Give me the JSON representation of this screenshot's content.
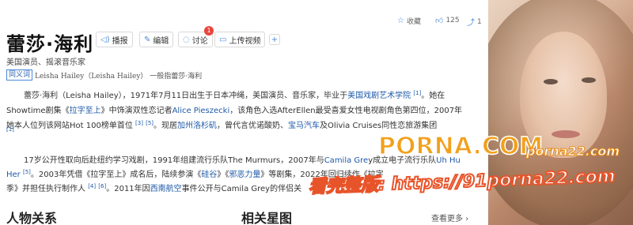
{
  "title": "蕾莎·海利",
  "top_actions": {
    "favorite": "收藏",
    "likes": "125",
    "shares": "1"
  },
  "toolbar": {
    "broadcast": "播报",
    "edit": "编辑",
    "discuss": "讨论",
    "discuss_badge": "1",
    "upload_video": "上传视频"
  },
  "description": "美国演员、摇滚音乐家",
  "synonym": {
    "tag": "同义词",
    "name": "Leisha Hailey（Leisha Hailey）",
    "rest": "一般指蕾莎·海利"
  },
  "para1": {
    "l1a": "蕾莎·海利（Leisha Hailey），1971年7月11日出生于日本冲绳，美国演员、音乐家，毕业于",
    "l1link": "美国戏剧艺术学院",
    "l1ref": "[1]",
    "l1b": "。她在",
    "l2a": "Showtime剧集《",
    "l2link1": "拉字至上",
    "l2b": "》中饰演双性恋记者",
    "l2link2": "Alice Pieszecki",
    "l2c": "，该角色入选AfterEllen最受喜爱女性电视剧角色第四位，2007年",
    "l3a": "她本人位列该网站Hot 100榜单首位",
    "l3ref1": "[3]",
    "l3ref2": "[5]",
    "l3b": "。现居",
    "l3link1": "加州洛杉矶",
    "l3c": "，曾代言优诺酸奶、",
    "l3link2": "宝马汽车",
    "l3d": "及Olivia Cruises同性恋旅游集团",
    "l4ref": "[1]"
  },
  "para2": {
    "l1a": "17岁公开性取向后赴纽约学习戏剧，1991年组建流行乐队The Murmurs，2007年与",
    "l1link1": "Camila Gre",
    "l1b": "y成立电子流行乐队",
    "l1link2": "Uh Hu",
    "l2link": "Her",
    "l2ref": "[5]",
    "l2a": "。2003年凭借《拉字至上》成名后，陆续参演《",
    "l2link2": "硅谷",
    "l2b": "》《",
    "l2link3": "邪恶力量",
    "l2c": "》等剧集，2022年回归续作《拉字",
    "l3a": "季》并担任执行制作人",
    "l3ref1": "[4]",
    "l3ref2": "[6]",
    "l3b": "。2011年因",
    "l3link": "西南航空",
    "l3c": "事件公开与Camila Grey的伴侣关"
  },
  "watermarks": {
    "main": "PORNA.COM",
    "site": "porna22.com",
    "url": "看完整版: https://91porna22.com"
  },
  "sections": {
    "relations": "人物关系",
    "stars": "相关星图",
    "more": "查看更多"
  },
  "icons": {
    "favorite": "star-icon",
    "like": "thumbs-up-icon",
    "share": "share-icon",
    "broadcast": "speaker-icon",
    "edit": "edit-icon",
    "discuss": "chat-icon",
    "upload": "video-icon",
    "add": "plus-icon"
  },
  "colors": {
    "link": "#1e5aa8",
    "accent": "#4a88d8",
    "badge": "#e8453c",
    "watermark": "#f2a01c"
  }
}
